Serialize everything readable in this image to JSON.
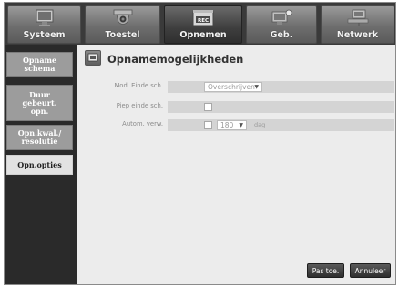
{
  "tabs": [
    {
      "label": "Systeem",
      "icon": "monitor-icon"
    },
    {
      "label": "Toestel",
      "icon": "camera-icon"
    },
    {
      "label": "Opnemen",
      "icon": "rec-icon",
      "badge": "REC"
    },
    {
      "label": "Geb.",
      "icon": "event-icon"
    },
    {
      "label": "Netwerk",
      "icon": "network-icon"
    }
  ],
  "menu": [
    {
      "label": "Opname\nschema"
    },
    {
      "label": "Duur\ngebeurt.\nopn."
    },
    {
      "label": "Opn.kwal./\nresolutie"
    },
    {
      "label": "Opn.opties"
    }
  ],
  "page": {
    "title": "Opnamemogelijkheden"
  },
  "settings": {
    "mode_end_label": "Mod. Einde sch.",
    "mode_end_value": "Overschrijven",
    "beep_end_label": "Piep einde sch.",
    "auto_delete_label": "Autom. verw.",
    "auto_delete_days": "180",
    "days_unit": "dag"
  },
  "buttons": {
    "apply": "Pas toe.",
    "cancel": "Annuleer"
  },
  "colors": {
    "active_menu": "#e2e2e2",
    "menu": "#9c9c9c",
    "panel": "#ececec",
    "band": "#d4d4d4"
  }
}
